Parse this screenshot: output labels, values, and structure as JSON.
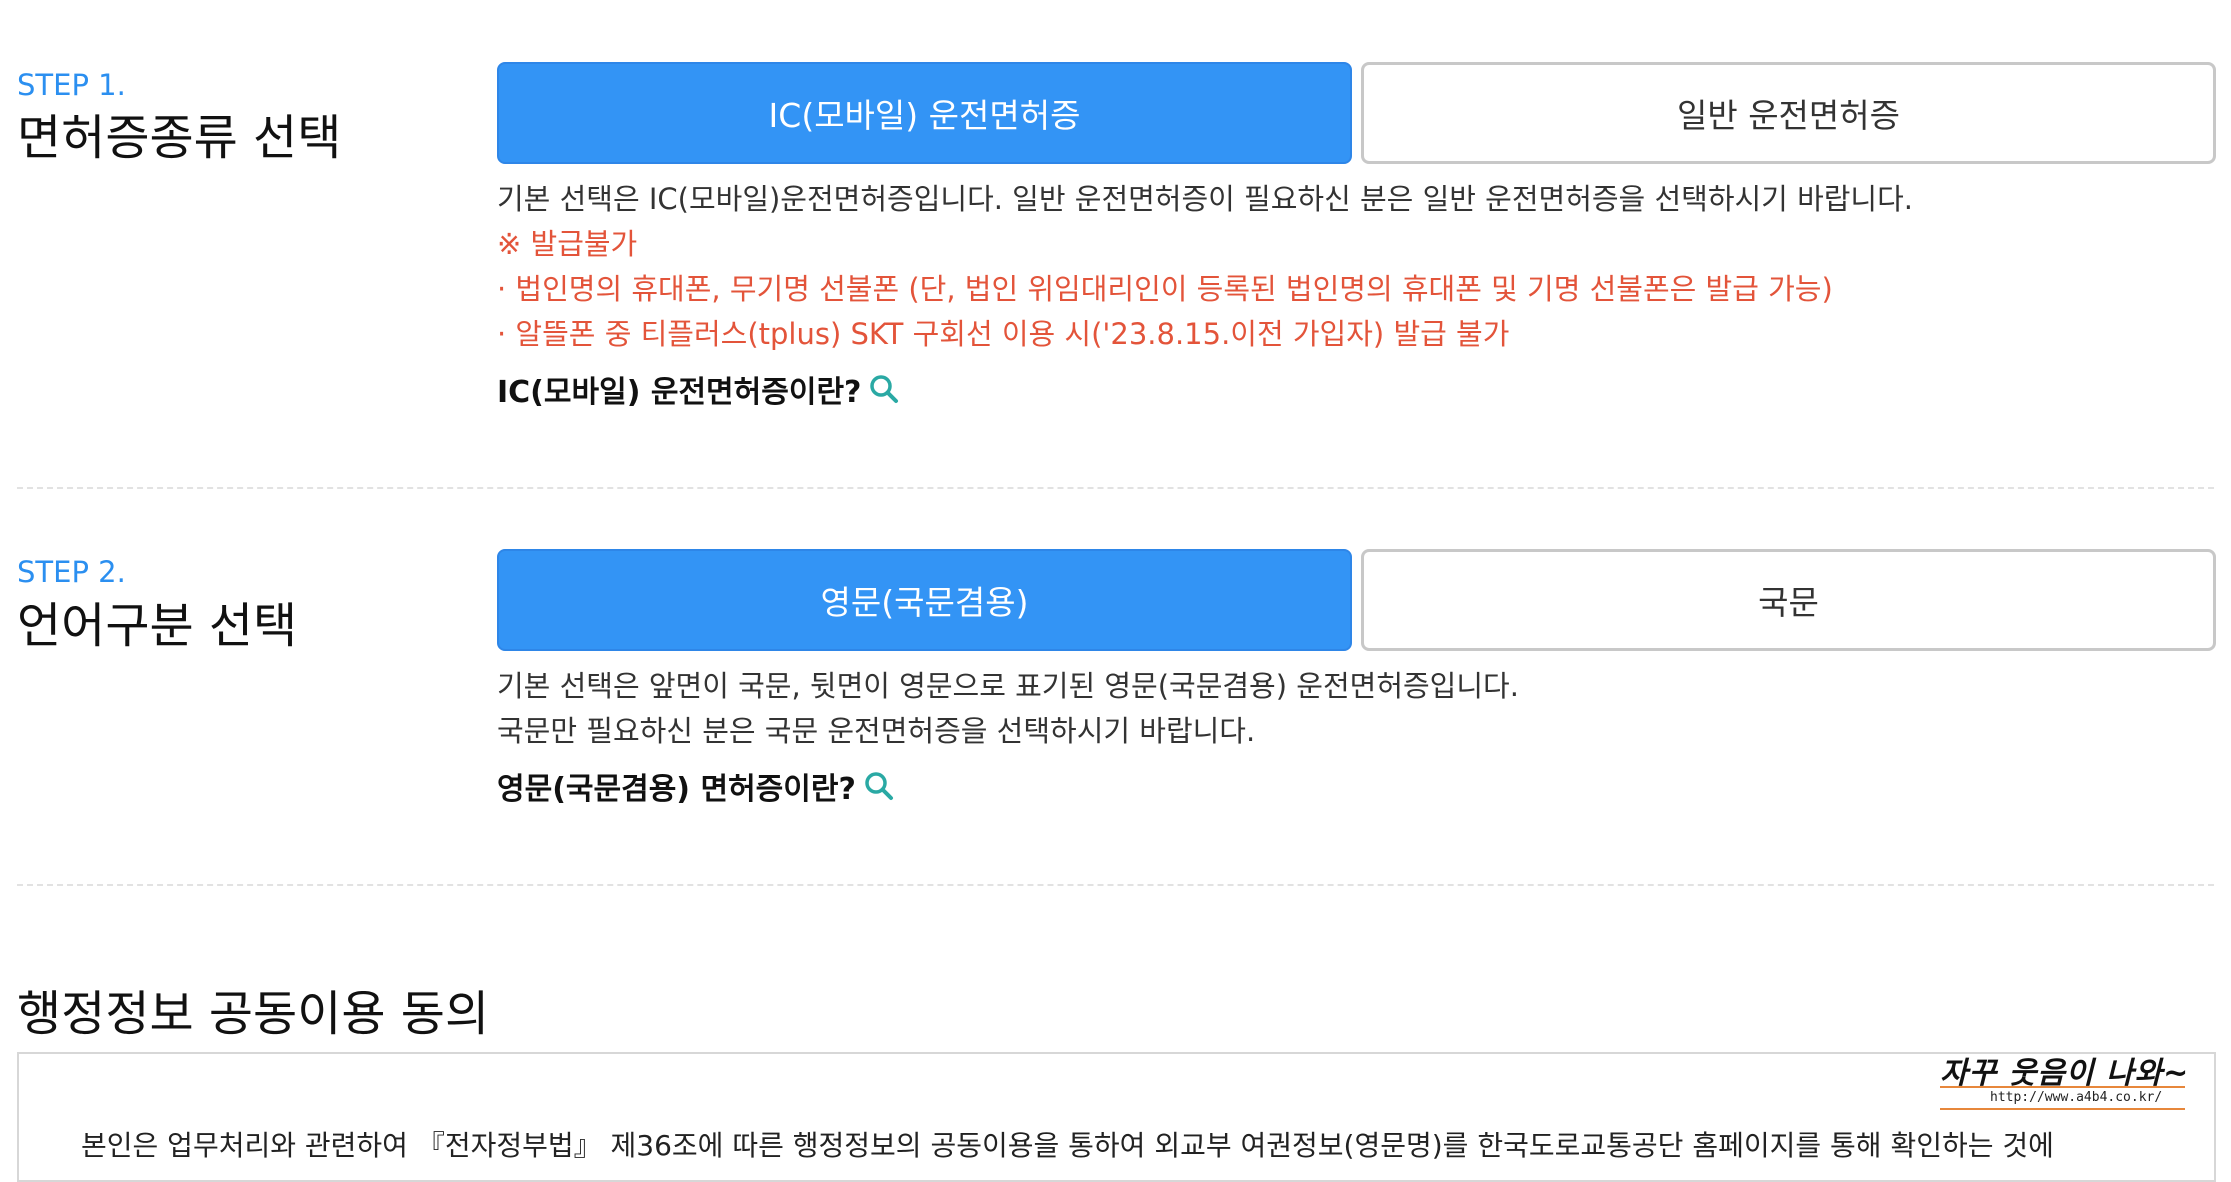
{
  "step1": {
    "label": "STEP 1.",
    "title": "면허증종류 선택",
    "option_selected": "IC(모바일) 운전면허증",
    "option_other": "일반 운전면허증",
    "desc": "기본 선택은 IC(모바일)운전면허증입니다. 일반 운전면허증이 필요하신 분은 일반 운전면허증을 선택하시기 바랍니다.",
    "notice_title": "※ 발급불가",
    "notice_1": "· 법인명의 휴대폰, 무기명 선불폰 (단, 법인 위임대리인이 등록된 법인명의 휴대폰 및 기명 선불폰은 발급 가능)",
    "notice_2": "· 알뜰폰 중 티플러스(tplus) SKT 구회선 이용 시('23.8.15.이전 가입자) 발급 불가",
    "info_link": "IC(모바일) 운전면허증이란?"
  },
  "step2": {
    "label": "STEP 2.",
    "title": "언어구분 선택",
    "option_selected": "영문(국문겸용)",
    "option_other": "국문",
    "desc_1": "기본 선택은 앞면이 국문, 뒷면이 영문으로 표기된 영문(국문겸용) 운전면허증입니다.",
    "desc_2": "국문만 필요하신 분은 국문 운전면허증을 선택하시기 바랍니다.",
    "info_link": "영문(국문겸용) 면허증이란?"
  },
  "consent": {
    "title": "행정정보 공동이용 동의",
    "text": "본인은 업무처리와 관련하여 『전자정부법』 제36조에 따른 행정정보의 공동이용을 통하여 외교부 여권정보(영문명)를 한국도로교통공단 홈페이지를 통해 확인하는 것에"
  },
  "watermark": {
    "text": "자꾸 웃음이 나와~",
    "url": "http://www.a4b4.co.kr/"
  },
  "colors": {
    "accent": "#3394f5",
    "step_label": "#2b8ff0",
    "notice_red": "#e3543a",
    "icon_teal": "#2aa9a4"
  },
  "icons": {
    "search": "search-icon"
  }
}
